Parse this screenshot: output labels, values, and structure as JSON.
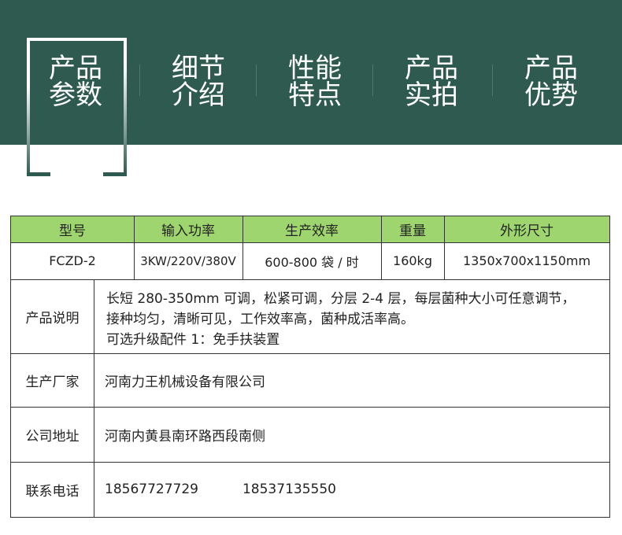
{
  "nav": {
    "tabs": [
      {
        "line1": "产品",
        "line2": "参数"
      },
      {
        "line1": "细节",
        "line2": "介绍"
      },
      {
        "line1": "性能",
        "line2": "特点"
      },
      {
        "line1": "产品",
        "line2": "实拍"
      },
      {
        "line1": "产品",
        "line2": "优势"
      }
    ],
    "active_index": 0
  },
  "colors": {
    "banner": "#2e5a4f",
    "table_header": "#9fd56e",
    "border": "#333333"
  },
  "table": {
    "headers": [
      "型号",
      "输入功率",
      "生产效率",
      "重量",
      "外形尺寸"
    ],
    "row": [
      "FCZD-2",
      "3KW/220V/380V",
      "600-800 袋 / 时",
      "160kg",
      "1350x700x1150mm"
    ]
  },
  "details": {
    "description_label": "产品说明",
    "description_lines": [
      "长短 280-350mm 可调，松紧可调，分层 2-4 层，每层菌种大小可任意调节，",
      "接种均匀，清晰可见，工作效率高，菌种成活率高。",
      "可选升级配件 1：免手扶装置"
    ],
    "manufacturer_label": "生产厂家",
    "manufacturer": "河南力王机械设备有限公司",
    "address_label": "公司地址",
    "address": "河南内黄县南环路西段南侧",
    "phone_label": "联系电话",
    "phones": [
      "18567727729",
      "18537135550"
    ]
  }
}
